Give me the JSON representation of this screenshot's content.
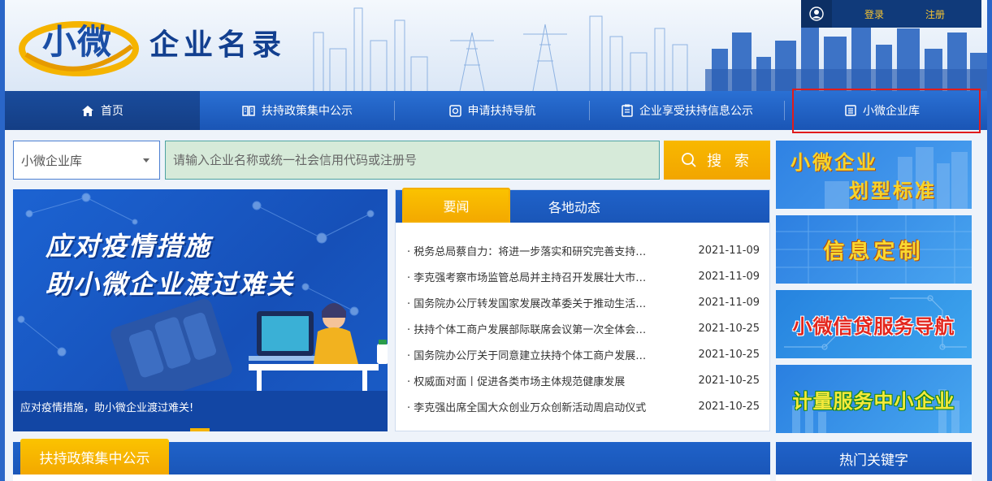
{
  "header": {
    "logo_text": "小微",
    "site_title": "企业名录",
    "user_links": {
      "login": "登录",
      "register": "注册"
    }
  },
  "nav": {
    "items": [
      {
        "label": "首页",
        "icon": "home-icon",
        "active": true
      },
      {
        "label": "扶持政策集中公示",
        "icon": "book-icon"
      },
      {
        "label": "申请扶持导航",
        "icon": "compass-icon"
      },
      {
        "label": "企业享受扶持信息公示",
        "icon": "clipboard-icon"
      },
      {
        "label": "小微企业库",
        "icon": "list-icon",
        "highlighted": true
      }
    ]
  },
  "search": {
    "select_value": "小微企业库",
    "placeholder": "请输入企业名称或统一社会信用代码或注册号",
    "button_label": "搜 索"
  },
  "hero": {
    "line1": "应对疫情措施",
    "line2": "助小微企业渡过难关",
    "caption": "应对疫情措施，助小微企业渡过难关!"
  },
  "news": {
    "tabs": [
      "要闻",
      "各地动态"
    ],
    "items": [
      {
        "title": "· 税务总局蔡自力：将进一步落实和研究完善支持小微企业发展的税费政策",
        "date": "2021-11-09"
      },
      {
        "title": "· 李克强考察市场监管总局并主持召开发展壮大市场主体座谈会",
        "date": "2021-11-09"
      },
      {
        "title": "· 国务院办公厅转发国家发展改革委关于推动生活性服务业补短板上水平",
        "date": "2021-11-09"
      },
      {
        "title": "· 扶持个体工商户发展部际联席会议第一次全体会议召开",
        "date": "2021-10-25"
      },
      {
        "title": "· 国务院办公厅关于同意建立扶持个体工商户发展部际联席会议制度的函",
        "date": "2021-10-25"
      },
      {
        "title": "· 权威面对面丨促进各类市场主体规范健康发展",
        "date": "2021-10-25"
      },
      {
        "title": "· 李克强出席全国大众创业万众创新活动周启动仪式",
        "date": "2021-10-25"
      }
    ]
  },
  "side_tiles": {
    "tile1_line1": "小微企业",
    "tile1_line2": "划型标准",
    "tile2": "信息定制",
    "tile3": "小微信贷服务导航",
    "tile4": "计量服务中小企业"
  },
  "bottom": {
    "policy_title": "扶持政策集中公示",
    "hot_title": "热门关键字"
  },
  "colors": {
    "nav_blue": "#1a55b5",
    "accent_orange": "#f3a800",
    "highlight_red": "#e01c1c",
    "link_gold": "#f7c531"
  }
}
